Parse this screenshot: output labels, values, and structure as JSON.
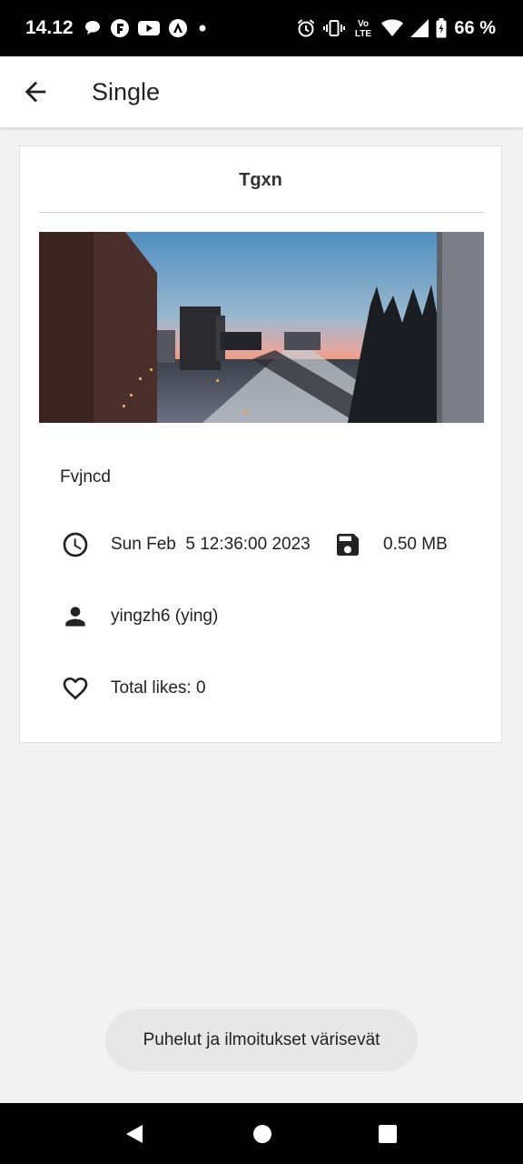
{
  "status_bar": {
    "time": "14.12",
    "battery": "66 %",
    "left_icons": [
      "chat-bubble-icon",
      "app-f-icon",
      "youtube-icon",
      "app-a-icon",
      "dot-icon"
    ],
    "right_icons": [
      "alarm-icon",
      "vibrate-icon",
      "volte-icon",
      "wifi-icon",
      "signal-icon",
      "battery-icon"
    ],
    "volte_label_top": "Vo",
    "volte_label_bottom": "LTE"
  },
  "app_bar": {
    "title": "Single",
    "back_icon": "arrow-back-icon"
  },
  "card": {
    "title": "Tgxn",
    "image_description_icon": "photo-icon",
    "description": "Fvjncd",
    "date": "Sun Feb  5 12:36:00 2023",
    "size": "0.50 MB",
    "user": "yingzh6 (ying)",
    "likes": "Total likes: 0"
  },
  "toast": {
    "text": "Puhelut ja ilmoitukset värisevät"
  },
  "nav_bar": {
    "icons": [
      "nav-back-icon",
      "nav-home-icon",
      "nav-recents-icon"
    ]
  },
  "colors": {
    "status_bar_bg": "#000000",
    "app_bar_bg": "#ffffff",
    "page_bg": "#f2f2f2",
    "card_bg": "#ffffff",
    "toast_bg": "#e7e7e7",
    "text": "#222222"
  }
}
